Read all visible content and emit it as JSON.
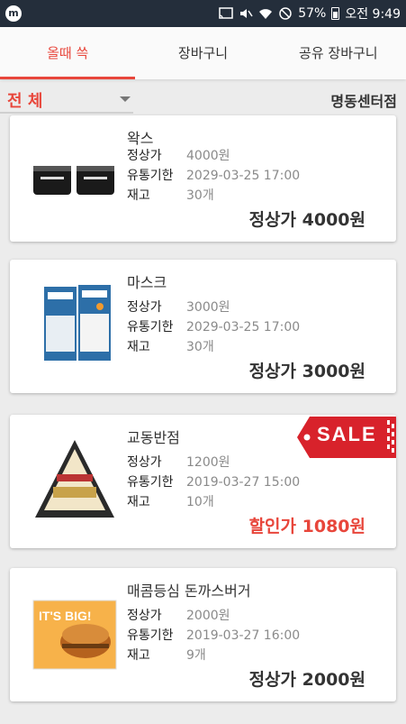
{
  "status_bar": {
    "battery": "57%",
    "time": "오전 9:49",
    "app_icon_letter": "m"
  },
  "tabs": [
    {
      "label": "올때 쓱",
      "active": true
    },
    {
      "label": "장바구니",
      "active": false
    },
    {
      "label": "공유 장바구니",
      "active": false
    }
  ],
  "filter": {
    "category": "전 체",
    "store": "명동센터점"
  },
  "labels": {
    "regular_price": "정상가",
    "expiry": "유통기한",
    "stock": "재고"
  },
  "products": [
    {
      "name": "왁스",
      "regular_price": "4000원",
      "expiry": "2029-03-25 17:00",
      "stock": "30개",
      "price_label": "정상가 4000원",
      "on_sale": false
    },
    {
      "name": "마스크",
      "regular_price": "3000원",
      "expiry": "2029-03-25 17:00",
      "stock": "30개",
      "price_label": "정상가 3000원",
      "on_sale": false
    },
    {
      "name": "교동반점",
      "regular_price": "1200원",
      "expiry": "2019-03-27 15:00",
      "stock": "10개",
      "price_label": "할인가 1080원",
      "on_sale": true,
      "sale_badge": "SALE"
    },
    {
      "name": "매콤등심 돈까스버거",
      "regular_price": "2000원",
      "expiry": "2019-03-27 16:00",
      "stock": "9개",
      "price_label": "정상가 2000원",
      "on_sale": false,
      "image_text": "IT'S BIG!"
    }
  ],
  "colors": {
    "accent": "#e8463b",
    "status_bar": "#242e3b",
    "muted_text": "#8a8a8a"
  }
}
